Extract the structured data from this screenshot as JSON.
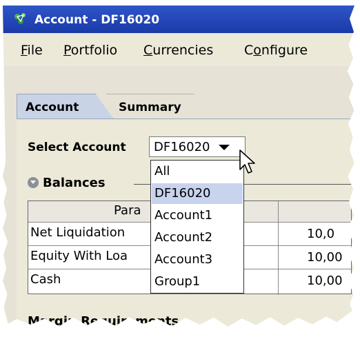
{
  "window": {
    "title": "Account - DF16020"
  },
  "menubar": {
    "items": [
      {
        "accel": "F",
        "rest": "ile"
      },
      {
        "accel": "P",
        "rest": "ortfolio"
      },
      {
        "accel": "C",
        "rest": "urrencies"
      },
      {
        "pre": "C",
        "accel": "o",
        "rest": "nfigure"
      }
    ]
  },
  "tabs": [
    {
      "label": "Account",
      "active": true
    },
    {
      "label": "Summary",
      "active": false
    }
  ],
  "account_selector": {
    "label": "Select Account",
    "value": "DF16020",
    "options": [
      "All",
      "DF16020",
      "Account1",
      "Account2",
      "Account3",
      "Group1"
    ],
    "selected_index": 1
  },
  "balances": {
    "title": "Balances",
    "column_header_partial": "Para",
    "rows": [
      {
        "name": "Net Liquidation",
        "value": "10,0"
      },
      {
        "name": "Equity With Loa",
        "value": "10,00"
      },
      {
        "name": "Cash",
        "value": "10,00"
      }
    ]
  },
  "margin_section": {
    "title": "Margin Requirements"
  },
  "colors": {
    "title_bar": "#1a3aa8",
    "active_tab": "#c9d3e6",
    "selected_option": "#c8d3ee"
  }
}
